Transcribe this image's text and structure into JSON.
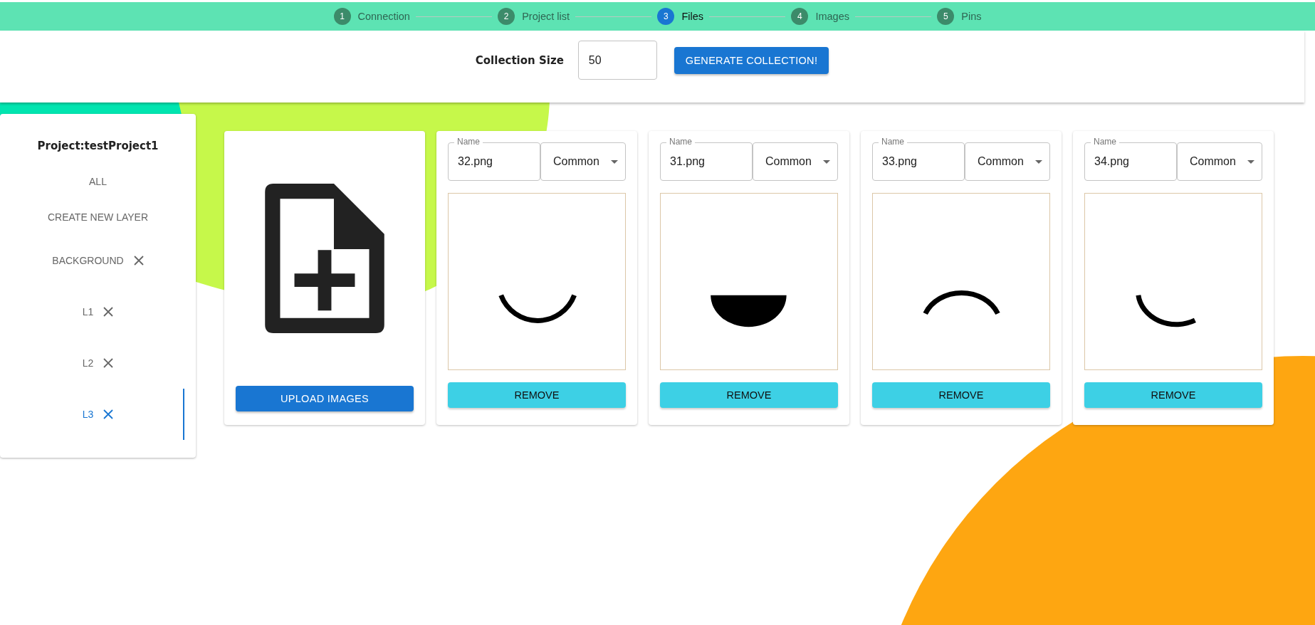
{
  "steps": [
    {
      "number": "1",
      "label": "Connection",
      "selected": false
    },
    {
      "number": "2",
      "label": "Project list",
      "selected": false
    },
    {
      "number": "3",
      "label": "Files",
      "selected": true
    },
    {
      "number": "4",
      "label": "Images",
      "selected": false
    },
    {
      "number": "5",
      "label": "Pins",
      "selected": false
    }
  ],
  "header": {
    "label": "Collection Size",
    "value": "50",
    "button": "GENERATE COLLECTION!"
  },
  "sidebar": {
    "title": "Project:testProject1",
    "items": [
      {
        "kind": "action",
        "label": "ALL",
        "selected": false
      },
      {
        "kind": "action",
        "label": "CREATE NEW LAYER",
        "selected": false
      },
      {
        "kind": "layer",
        "label": "BACKGROUND",
        "selected": false
      },
      {
        "kind": "layer",
        "label": "L1",
        "selected": false
      },
      {
        "kind": "layer",
        "label": "L2",
        "selected": false
      },
      {
        "kind": "layer",
        "label": "L3",
        "selected": true
      }
    ]
  },
  "upload": {
    "button": "UPLOAD IMAGES"
  },
  "files": [
    {
      "name_label": "Name",
      "name": "32.png",
      "rarity": "Common",
      "kind": "smile",
      "button": "REMOVE"
    },
    {
      "name_label": "Name",
      "name": "31.png",
      "rarity": "Common",
      "kind": "half-disc",
      "button": "REMOVE"
    },
    {
      "name_label": "Name",
      "name": "33.png",
      "rarity": "Common",
      "kind": "frown",
      "button": "REMOVE"
    },
    {
      "name_label": "Name",
      "name": "34.png",
      "rarity": "Common",
      "kind": "smirk",
      "button": "REMOVE"
    }
  ]
}
